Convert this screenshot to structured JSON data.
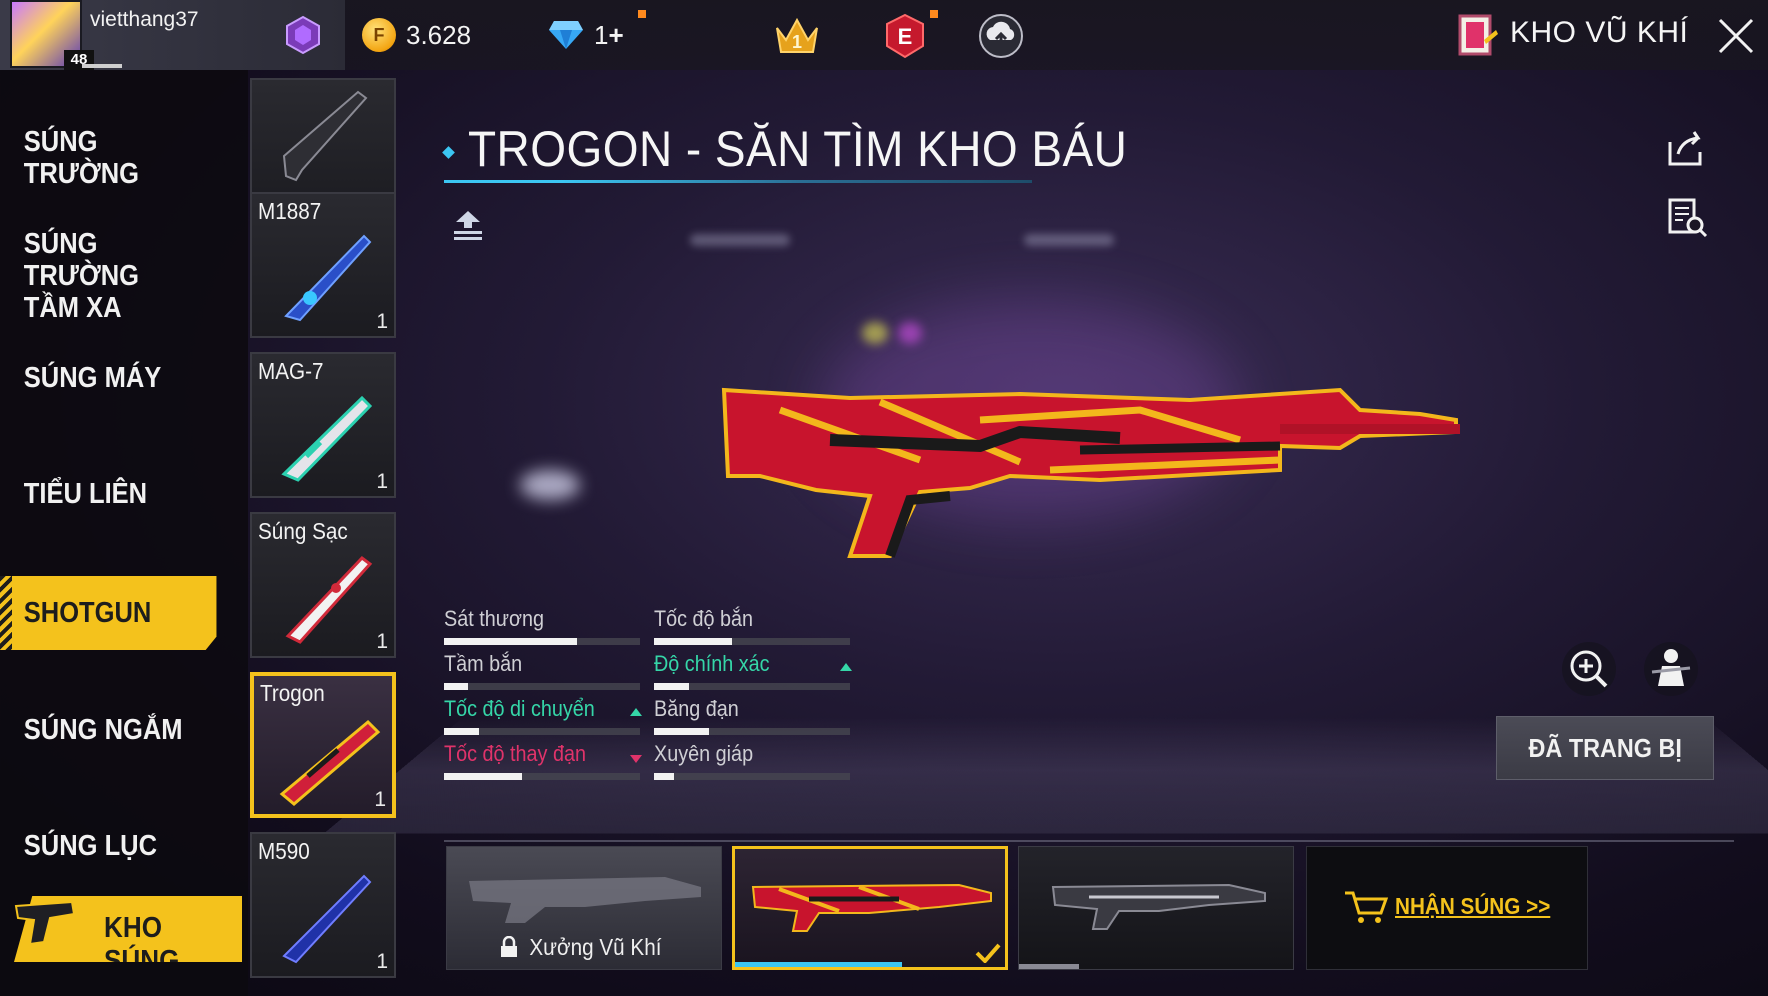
{
  "player": {
    "name": "vietthang37",
    "level": "48"
  },
  "currency": {
    "gold": "3.628",
    "diamonds": "1",
    "diamonds_plus": "+"
  },
  "header": {
    "section_title": "KHO VŨ KHÍ"
  },
  "categories": [
    {
      "label": "SÚNG TRƯỜNG"
    },
    {
      "label": "SÚNG TRƯỜNG\nTẦM XA"
    },
    {
      "label": "SÚNG MÁY"
    },
    {
      "label": "TIỂU LIÊN"
    },
    {
      "label": "SHOTGUN",
      "active": true
    },
    {
      "label": "SÚNG NGẮM"
    },
    {
      "label": "SÚNG LỤC"
    }
  ],
  "kho_sung": {
    "label": "KHO SÚNG"
  },
  "weapons": [
    {
      "name": "",
      "count": ""
    },
    {
      "name": "M1887",
      "count": "1"
    },
    {
      "name": "MAG-7",
      "count": "1"
    },
    {
      "name": "Súng Sạc",
      "count": "1"
    },
    {
      "name": "Trogon",
      "count": "1",
      "selected": true
    },
    {
      "name": "M590",
      "count": "1"
    }
  ],
  "skin": {
    "title": "TROGON - SĂN TÌM KHO BÁU"
  },
  "stats": [
    {
      "label": "Sát thương",
      "value": 0.68,
      "trend": "none"
    },
    {
      "label": "Tốc độ bắn",
      "value": 0.4,
      "trend": "none"
    },
    {
      "label": "Tầm bắn",
      "value": 0.12,
      "trend": "none"
    },
    {
      "label": "Độ chính xác",
      "value": 0.18,
      "trend": "up"
    },
    {
      "label": "Tốc độ di chuyển",
      "value": 0.18,
      "trend": "up"
    },
    {
      "label": "Băng đạn",
      "value": 0.28,
      "trend": "none"
    },
    {
      "label": "Tốc độ thay đạn",
      "value": 0.4,
      "trend": "down"
    },
    {
      "label": "Xuyên giáp",
      "value": 0.1,
      "trend": "none"
    }
  ],
  "actions": {
    "equipped": "ĐÃ TRANG BỊ",
    "get_gun": "NHẬN SÚNG >>",
    "workshop": "Xưởng Vũ Khí"
  },
  "colors": {
    "accent_yellow": "#f4c21c",
    "accent_cyan": "#3cc6f2",
    "stat_up": "#35d6a8",
    "stat_down": "#e0336a"
  }
}
